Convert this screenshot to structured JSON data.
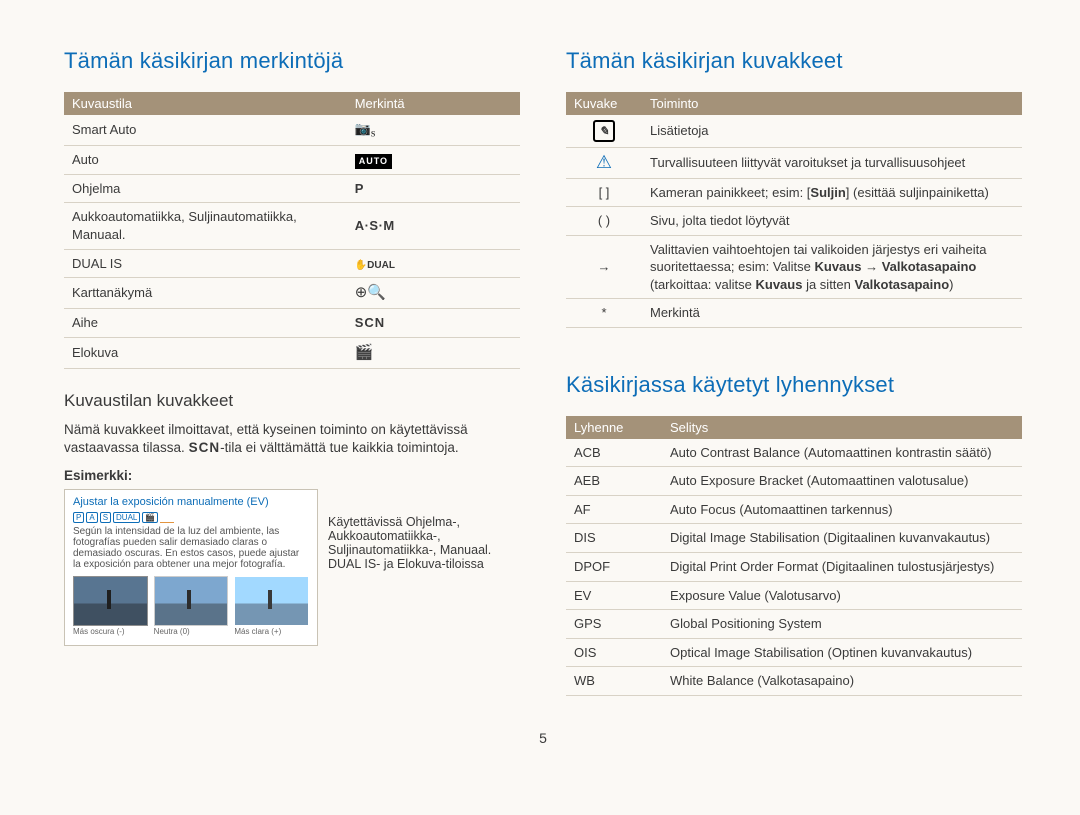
{
  "left": {
    "title": "Tämän käsikirjan merkintöjä",
    "table1": {
      "headers": [
        "Kuvaustila",
        "Merkintä"
      ],
      "rows": [
        {
          "mode": "Smart Auto",
          "mark": "camera-s"
        },
        {
          "mode": "Auto",
          "mark": "auto-chip"
        },
        {
          "mode": "Ohjelma",
          "mark": "P"
        },
        {
          "mode": "Aukkoautomatiikka, Suljinautomatiikka, Manuaal.",
          "mark": "A·S·M"
        },
        {
          "mode": "DUAL IS",
          "mark": "dual"
        },
        {
          "mode": "Karttanäkymä",
          "mark": "map"
        },
        {
          "mode": "Aihe",
          "mark": "SCN"
        },
        {
          "mode": "Elokuva",
          "mark": "film"
        }
      ]
    },
    "sub": "Kuvaustilan kuvakkeet",
    "desc_a": "Nämä kuvakkeet ilmoittavat, että kyseinen toiminto on käytettävissä vastaavassa tilassa. ",
    "desc_scn": "SCN",
    "desc_b": "-tila ei välttämättä tue kaikkia toimintoja.",
    "example_label": "Esimerkki:",
    "example_title": "Ajustar la exposición manualmente (EV)",
    "example_badges": [
      "P",
      "A",
      "S",
      "DUAL",
      "film"
    ],
    "example_body": "Según la intensidad de la luz del ambiente, las fotografías pueden salir demasiado claras o demasiado oscuras. En estos casos, puede ajustar la exposición para obtener una mejor fotografía.",
    "thumbs": [
      "Más oscura (-)",
      "Neutra (0)",
      "Más clara (+)"
    ],
    "example_note": "Käytettävissä Ohjelma-, Aukkoautomatiikka-, Suljinautomatiikka-, Manuaal. DUAL IS- ja Elokuva-tiloissa"
  },
  "right": {
    "title1": "Tämän käsikirjan kuvakkeet",
    "table2": {
      "headers": [
        "Kuvake",
        "Toiminto"
      ],
      "rows": [
        {
          "icon": "info",
          "text": "Lisätietoja"
        },
        {
          "icon": "warn",
          "text": "Turvallisuuteen liittyvät varoitukset ja turvallisuusohjeet"
        },
        {
          "icon": "[ ]",
          "html": "Kameran painikkeet; esim: [<b>Suljin</b>] (esittää suljinpainiketta)"
        },
        {
          "icon": "( )",
          "text": "Sivu, jolta tiedot löytyvät"
        },
        {
          "icon": "→",
          "html": "Valittavien vaihtoehtojen tai valikoiden järjestys eri vaiheita suoritettaessa; esim: Valitse <b>Kuvaus</b> → <b>Valkotasapaino</b> (tarkoittaa: valitse <b>Kuvaus</b> ja sitten <b>Valkotasapaino</b>)"
        },
        {
          "icon": "*",
          "text": "Merkintä"
        }
      ]
    },
    "title2": "Käsikirjassa käytetyt lyhennykset",
    "table3": {
      "headers": [
        "Lyhenne",
        "Selitys"
      ],
      "rows": [
        {
          "abbr": "ACB",
          "def": "Auto Contrast Balance (Automaattinen kontrastin säätö)"
        },
        {
          "abbr": "AEB",
          "def": "Auto Exposure Bracket (Automaattinen valotusalue)"
        },
        {
          "abbr": "AF",
          "def": "Auto Focus (Automaattinen tarkennus)"
        },
        {
          "abbr": "DIS",
          "def": "Digital Image Stabilisation (Digitaalinen kuvanvakautus)"
        },
        {
          "abbr": "DPOF",
          "def": "Digital Print Order Format (Digitaalinen tulostusjärjestys)"
        },
        {
          "abbr": "EV",
          "def": "Exposure Value (Valotusarvo)"
        },
        {
          "abbr": "GPS",
          "def": "Global Positioning System"
        },
        {
          "abbr": "OIS",
          "def": "Optical Image Stabilisation (Optinen kuvanvakautus)"
        },
        {
          "abbr": "WB",
          "def": "White Balance (Valkotasapaino)"
        }
      ]
    }
  },
  "page_number": "5"
}
